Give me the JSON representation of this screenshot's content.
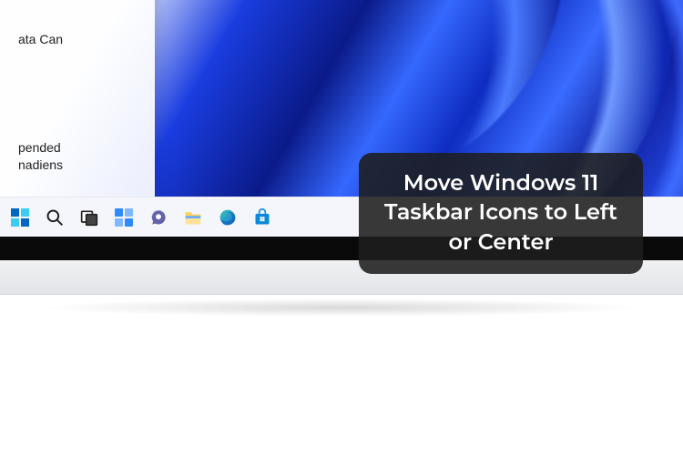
{
  "desktop": {
    "panel": {
      "line1a": "ata Can",
      "line2a": "pended",
      "line2b": "nadiens"
    }
  },
  "taskbar": {
    "icons": [
      {
        "name": "start-icon"
      },
      {
        "name": "search-icon"
      },
      {
        "name": "task-view-icon"
      },
      {
        "name": "widgets-icon"
      },
      {
        "name": "chat-icon"
      },
      {
        "name": "file-explorer-icon"
      },
      {
        "name": "edge-icon"
      },
      {
        "name": "store-icon"
      }
    ]
  },
  "overlay": {
    "title": "Move Windows 11 Taskbar Icons to Left or Center"
  },
  "colors": {
    "win_blue": "#0067c0",
    "win_cyan": "#3ccbf4",
    "folder": "#ffd257",
    "edge_grad_a": "#38c7b0",
    "edge_grad_b": "#1a6fe3",
    "store": "#0b88d8",
    "chat": "#6264a7"
  }
}
